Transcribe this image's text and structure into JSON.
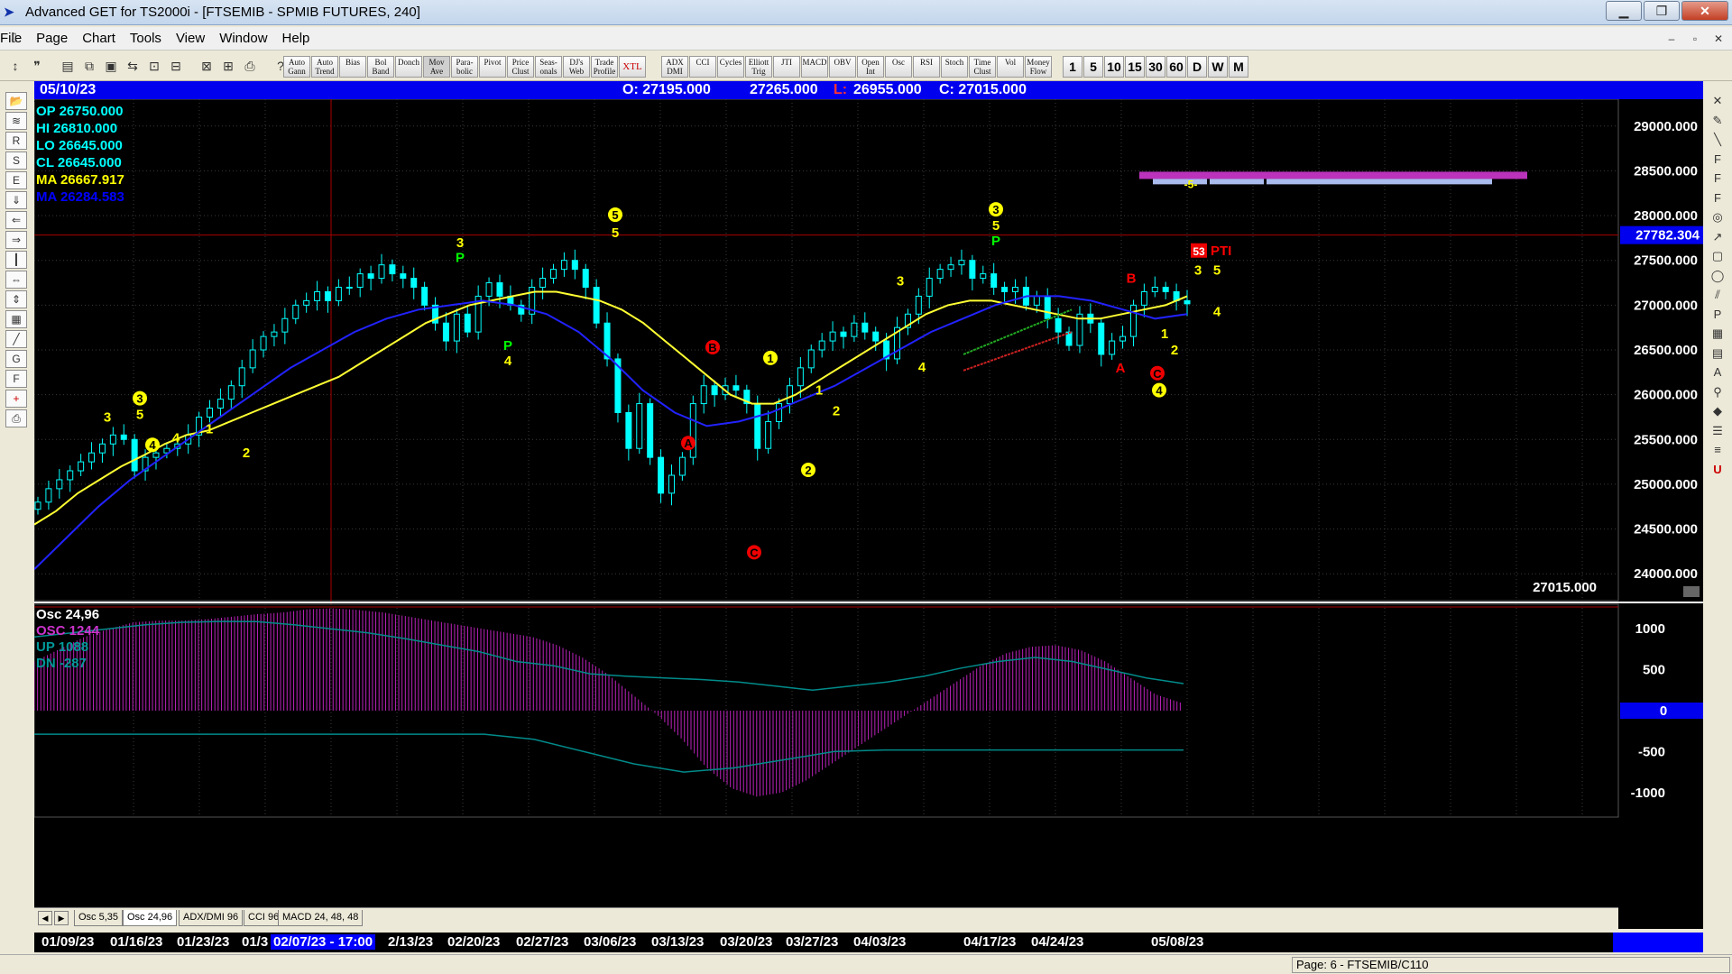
{
  "window": {
    "title": "Advanced GET for TS2000i - [FTSEMIB - SPMIB FUTURES, 240]",
    "min": "▁",
    "max": "❐",
    "close": "✕"
  },
  "menu": [
    "File",
    "Page",
    "Chart",
    "Tools",
    "View",
    "Window",
    "Help"
  ],
  "toolbar": {
    "studies": [
      "Auto Gann",
      "Auto Trend",
      "Bias",
      "Bol Band",
      "Donch",
      "Mov Ave",
      "Para- bolic",
      "Pivot",
      "Price Clust",
      "Seas- onals",
      "DJ's Web",
      "Trade Profile",
      "XTL",
      "ADX DMI",
      "CCI",
      "Cycles",
      "Elliott Trig",
      "JTI",
      "MACD",
      "OBV",
      "Open Int",
      "Osc",
      "RSI",
      "Stoch",
      "Time Clust",
      "Vol",
      "Money Flow"
    ],
    "timeframes": [
      "1",
      "5",
      "10",
      "15",
      "30",
      "60",
      "D",
      "W",
      "M"
    ]
  },
  "header": {
    "date": "05/10/23",
    "open": "O: 27195.000",
    "high": "27265.000",
    "low_label": "L:",
    "low": "26955.000",
    "close": "C: 27015.000"
  },
  "legend": {
    "op": "OP  26750.000",
    "hi": "HI   26810.000",
    "lo": "LO  26645.000",
    "cl": "CL  26645.000",
    "ma1": "MA  26667.917",
    "ma2": "MA  26284.583",
    "colors": {
      "op": "#00ffff",
      "ma1": "#ffff00",
      "ma2": "#0000ff"
    }
  },
  "price_axis": {
    "labels": [
      "29000.000",
      "28500.000",
      "28000.000",
      "27500.000",
      "27000.000",
      "26500.000",
      "26000.000",
      "25500.000",
      "25000.000",
      "24500.000",
      "24000.000"
    ],
    "values": [
      29000,
      28500,
      28000,
      27500,
      27000,
      26500,
      26000,
      25500,
      25000,
      24500,
      24000
    ],
    "hline_value": 27782.304,
    "hline_label": "27782.304",
    "last_price": "27015.000"
  },
  "osc_panel": {
    "title": "Osc 24,96",
    "osc": "OSC 1244",
    "up": "UP     1088",
    "dn": "DN    -287",
    "axis_labels": [
      "1000",
      "500",
      "0",
      "-500",
      "-1000"
    ],
    "axis_values": [
      1000,
      500,
      0,
      -500,
      -1000
    ],
    "zero_label": "0",
    "colors": {
      "osc": "#cc33cc",
      "up": "#009999",
      "dn": "#009999"
    }
  },
  "chart_data": {
    "type": "candlestick",
    "symbol": "FTSEMIB",
    "ylim": [
      23700,
      29300
    ],
    "closes": [
      24800,
      24950,
      25050,
      25150,
      25250,
      25350,
      25450,
      25550,
      25500,
      25150,
      25300,
      25350,
      25400,
      25450,
      25550,
      25750,
      25850,
      25950,
      26100,
      26300,
      26500,
      26650,
      26700,
      26850,
      27000,
      27050,
      27150,
      27050,
      27200,
      27200,
      27350,
      27300,
      27450,
      27350,
      27300,
      27200,
      27000,
      26800,
      26600,
      26900,
      26700,
      27100,
      27250,
      27100,
      27000,
      26900,
      27200,
      27300,
      27400,
      27500,
      27400,
      27200,
      26800,
      26400,
      25800,
      25400,
      25900,
      25300,
      24900,
      25100,
      25300,
      25900,
      26100,
      26000,
      26100,
      26050,
      25900,
      25400,
      25700,
      25900,
      26100,
      26300,
      26500,
      26600,
      26700,
      26650,
      26800,
      26700,
      26600,
      26400,
      26750,
      26900,
      27100,
      27300,
      27400,
      27450,
      27500,
      27300,
      27350,
      27200,
      27150,
      27200,
      27000,
      27100,
      26850,
      26700,
      26550,
      26900,
      26800,
      26450,
      26600,
      26650,
      27000,
      27150,
      27200,
      27150,
      27050,
      27015
    ],
    "ma_yellow": [
      24550,
      24700,
      24900,
      25050,
      25200,
      25320,
      25450,
      25550,
      25600,
      25700,
      25800,
      25900,
      26000,
      26100,
      26200,
      26350,
      26500,
      26650,
      26800,
      26900,
      27000,
      27050,
      27100,
      27150,
      27150,
      27100,
      27050,
      26950,
      26800,
      26600,
      26400,
      26200,
      26000,
      25900,
      25900,
      26000,
      26150,
      26300,
      26450,
      26600,
      26750,
      26900,
      27000,
      27050,
      27050,
      27000,
      26950,
      26900,
      26850,
      26850,
      26900,
      26950,
      27000,
      27100
    ],
    "ma_blue": [
      24050,
      24400,
      24750,
      25050,
      25300,
      25550,
      25800,
      26050,
      26300,
      26500,
      26700,
      26850,
      26950,
      27000,
      27050,
      27000,
      26900,
      26700,
      26400,
      26050,
      25800,
      25650,
      25700,
      25800,
      25950,
      26100,
      26300,
      26500,
      26700,
      26850,
      27000,
      27100,
      27100,
      27050,
      26950,
      26850,
      26900
    ],
    "osc_values": [
      600,
      750,
      900,
      1000,
      1080,
      1100,
      1100,
      1120,
      1150,
      1180,
      1200,
      1240,
      1250,
      1230,
      1200,
      1150,
      1100,
      1050,
      1000,
      950,
      900,
      800,
      650,
      450,
      200,
      -50,
      -350,
      -700,
      -950,
      -1050,
      -1000,
      -850,
      -650,
      -450,
      -250,
      -50,
      150,
      350,
      550,
      700,
      780,
      800,
      740,
      600,
      400,
      200,
      100
    ],
    "up_line": [
      900,
      950,
      1000,
      1050,
      1080,
      1090,
      1088,
      1050,
      1000,
      950,
      880,
      800,
      720,
      600,
      550,
      450,
      420,
      400,
      380,
      350,
      300,
      250,
      300,
      350,
      420,
      520,
      600,
      650,
      600,
      500,
      400,
      330
    ],
    "dn_line": [
      -287,
      -287,
      -287,
      -287,
      -287,
      -287,
      -287,
      -287,
      -287,
      -287,
      -350,
      -500,
      -650,
      -750,
      -700,
      -600,
      -500,
      -480,
      -480,
      -480,
      -480,
      -480,
      -480,
      -480
    ],
    "annotations": [
      {
        "text": "3",
        "color": "#ffff00"
      },
      {
        "text": "5",
        "color": "#ffff00"
      },
      {
        "text": "P",
        "color": "#00ff00"
      },
      {
        "text": "4",
        "color": "#ffff00"
      },
      {
        "text": "1",
        "color": "#ffff00"
      },
      {
        "text": "2",
        "color": "#ffff00"
      },
      {
        "text": "A",
        "color": "#ff0000"
      },
      {
        "text": "B",
        "color": "#ff0000"
      },
      {
        "text": "C",
        "color": "#ff0000"
      },
      {
        "text": "PTI",
        "color": "#ff0000"
      },
      {
        "text": "53",
        "color": "#ffffff"
      },
      {
        "text": "-5-",
        "color": "#ffff00"
      }
    ],
    "x_labels": [
      "01/09/23",
      "01/16/23",
      "01/23/23",
      "01/3",
      "02/07/23 - 17:00",
      "2/13/23",
      "02/20/23",
      "02/27/23",
      "03/06/23",
      "03/13/23",
      "03/20/23",
      "03/27/23",
      "04/03/23",
      "04/17/23",
      "04/24/23",
      "05/08/23"
    ]
  },
  "tabs": [
    "Osc 5,35",
    "Osc 24,96",
    "ADX/DMI 96",
    "CCI 96",
    "MACD 24, 48, 48"
  ],
  "tab_nav": {
    "prev": "◀",
    "next": "▶"
  },
  "status": {
    "page": "Page: 6 - FTSEMIB/C110"
  },
  "icons": {
    "app": "app-icon",
    "left_tools": [
      "open-icon",
      "wave-icon",
      "reset-icon",
      "study-icon",
      "elliott-icon",
      "down-arrow-icon",
      "left-arrow-icon",
      "right-arrow-icon",
      "bars-icon",
      "compress-icon",
      "expand-icon",
      "grid-icon",
      "lines-icon",
      "gann-icon",
      "fib-icon",
      "crosshair-icon",
      "print-icon"
    ],
    "right_tools": [
      "cross-icon",
      "pencil-icon",
      "line-icon",
      "fib-ret-icon",
      "fib-ext-icon",
      "fib-time-icon",
      "circle-icon",
      "ray-icon",
      "rect-icon",
      "ellipse-icon",
      "channel-icon",
      "pti-icon",
      "grid-icon",
      "fib-box-icon",
      "text-icon",
      "zoom-icon",
      "marker-icon",
      "stack-icon",
      "layers-icon",
      "magnet-icon"
    ]
  }
}
